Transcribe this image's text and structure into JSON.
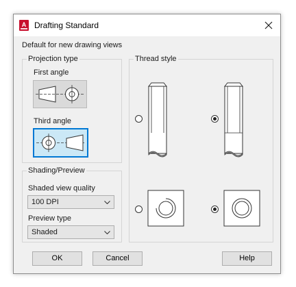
{
  "window": {
    "title": "Drafting Standard",
    "app_icon_letter": "A",
    "close_glyph": "✕"
  },
  "dialog": {
    "subtitle": "Default for new drawing views"
  },
  "projection": {
    "group_label": "Projection type",
    "first_angle_label": "First angle",
    "third_angle_label": "Third angle",
    "selected": "Third angle"
  },
  "shading": {
    "group_label": "Shading/Preview",
    "quality_label": "Shaded view quality",
    "quality_value": "100 DPI",
    "preview_label": "Preview type",
    "preview_value": "Shaded"
  },
  "thread": {
    "group_label": "Thread style",
    "options": [
      {
        "view": "side",
        "style": "plain",
        "selected": false
      },
      {
        "view": "side",
        "style": "with-thread-lines",
        "selected": true
      },
      {
        "view": "end",
        "style": "gap-arc",
        "selected": false
      },
      {
        "view": "end",
        "style": "full-circle",
        "selected": true
      }
    ]
  },
  "buttons": {
    "ok": "OK",
    "cancel": "Cancel",
    "help": "Help"
  },
  "colors": {
    "app_icon": "#c8102e",
    "selection_border": "#0078d4",
    "selection_fill": "#cbe8f6"
  }
}
